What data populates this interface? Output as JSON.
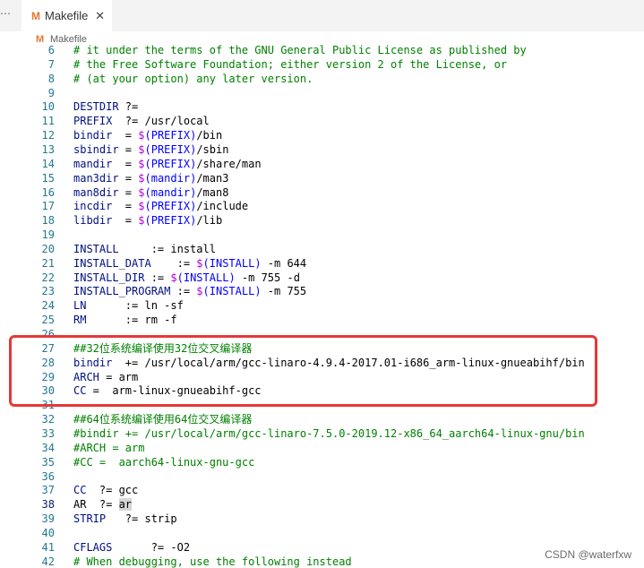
{
  "tab": {
    "more": "⋯",
    "icon_letter": "M",
    "label": "Makefile",
    "close": "✕"
  },
  "breadcrumb": {
    "icon_letter": "M",
    "label": "Makefile"
  },
  "editor": {
    "active_line": 38,
    "lines": [
      {
        "n": "6",
        "t": "# it under the terms of the GNU General Public License as published by",
        "k": "cmt"
      },
      {
        "n": "7",
        "t": "# the Free Software Foundation; either version 2 of the License, or",
        "k": "cmt"
      },
      {
        "n": "8",
        "t": "# (at your option) any later version.",
        "k": "cmt"
      },
      {
        "n": "9",
        "t": "",
        "k": ""
      },
      {
        "n": "10",
        "t": "DESTDIR ?=",
        "k": ""
      },
      {
        "n": "11",
        "t": "PREFIX  ?= /usr/local",
        "k": ""
      },
      {
        "n": "12",
        "t": "bindir  = $(PREFIX)/bin",
        "k": ""
      },
      {
        "n": "13",
        "t": "sbindir = $(PREFIX)/sbin",
        "k": ""
      },
      {
        "n": "14",
        "t": "mandir  = $(PREFIX)/share/man",
        "k": ""
      },
      {
        "n": "15",
        "t": "man3dir = $(mandir)/man3",
        "k": ""
      },
      {
        "n": "16",
        "t": "man8dir = $(mandir)/man8",
        "k": ""
      },
      {
        "n": "17",
        "t": "incdir  = $(PREFIX)/include",
        "k": ""
      },
      {
        "n": "18",
        "t": "libdir  = $(PREFIX)/lib",
        "k": ""
      },
      {
        "n": "19",
        "t": "",
        "k": ""
      },
      {
        "n": "20",
        "t": "INSTALL     := install",
        "k": ""
      },
      {
        "n": "21",
        "t": "INSTALL_DATA    := $(INSTALL) -m 644",
        "k": ""
      },
      {
        "n": "22",
        "t": "INSTALL_DIR := $(INSTALL) -m 755 -d",
        "k": ""
      },
      {
        "n": "23",
        "t": "INSTALL_PROGRAM := $(INSTALL) -m 755",
        "k": ""
      },
      {
        "n": "24",
        "t": "LN      := ln -sf",
        "k": ""
      },
      {
        "n": "25",
        "t": "RM      := rm -f",
        "k": ""
      },
      {
        "n": "26",
        "t": "",
        "k": ""
      },
      {
        "n": "27",
        "t": "##32位系统编译使用32位交叉编译器",
        "k": "cmt"
      },
      {
        "n": "28",
        "t": "bindir  += /usr/local/arm/gcc-linaro-4.9.4-2017.01-i686_arm-linux-gnueabihf/bin",
        "k": ""
      },
      {
        "n": "29",
        "t": "ARCH = arm",
        "k": ""
      },
      {
        "n": "30",
        "t": "CC =  arm-linux-gnueabihf-gcc",
        "k": ""
      },
      {
        "n": "31",
        "t": "",
        "k": ""
      },
      {
        "n": "32",
        "t": "##64位系统编译使用64位交叉编译器",
        "k": "cmt"
      },
      {
        "n": "33",
        "t": "#bindir += /usr/local/arm/gcc-linaro-7.5.0-2019.12-x86_64_aarch64-linux-gnu/bin",
        "k": "cmt"
      },
      {
        "n": "34",
        "t": "#ARCH = arm",
        "k": "cmt"
      },
      {
        "n": "35",
        "t": "#CC =  aarch64-linux-gnu-gcc",
        "k": "cmt"
      },
      {
        "n": "36",
        "t": "",
        "k": ""
      },
      {
        "n": "37",
        "t": "CC  ?= gcc",
        "k": ""
      },
      {
        "n": "38",
        "t": "AR  ?= ar",
        "k": "hl"
      },
      {
        "n": "39",
        "t": "STRIP   ?= strip",
        "k": ""
      },
      {
        "n": "40",
        "t": "",
        "k": ""
      },
      {
        "n": "41",
        "t": "CFLAGS      ?= -O2",
        "k": ""
      },
      {
        "n": "42",
        "t": "# When debugging, use the following instead",
        "k": "cmt"
      }
    ]
  },
  "watermark": "CSDN @waterfxw",
  "colors": {
    "comment": "#008000",
    "variable": "#001080",
    "dollar": "#af00db",
    "line_number": "#237893",
    "highlight_box": "#e53935",
    "makefile_icon": "#e37933"
  }
}
